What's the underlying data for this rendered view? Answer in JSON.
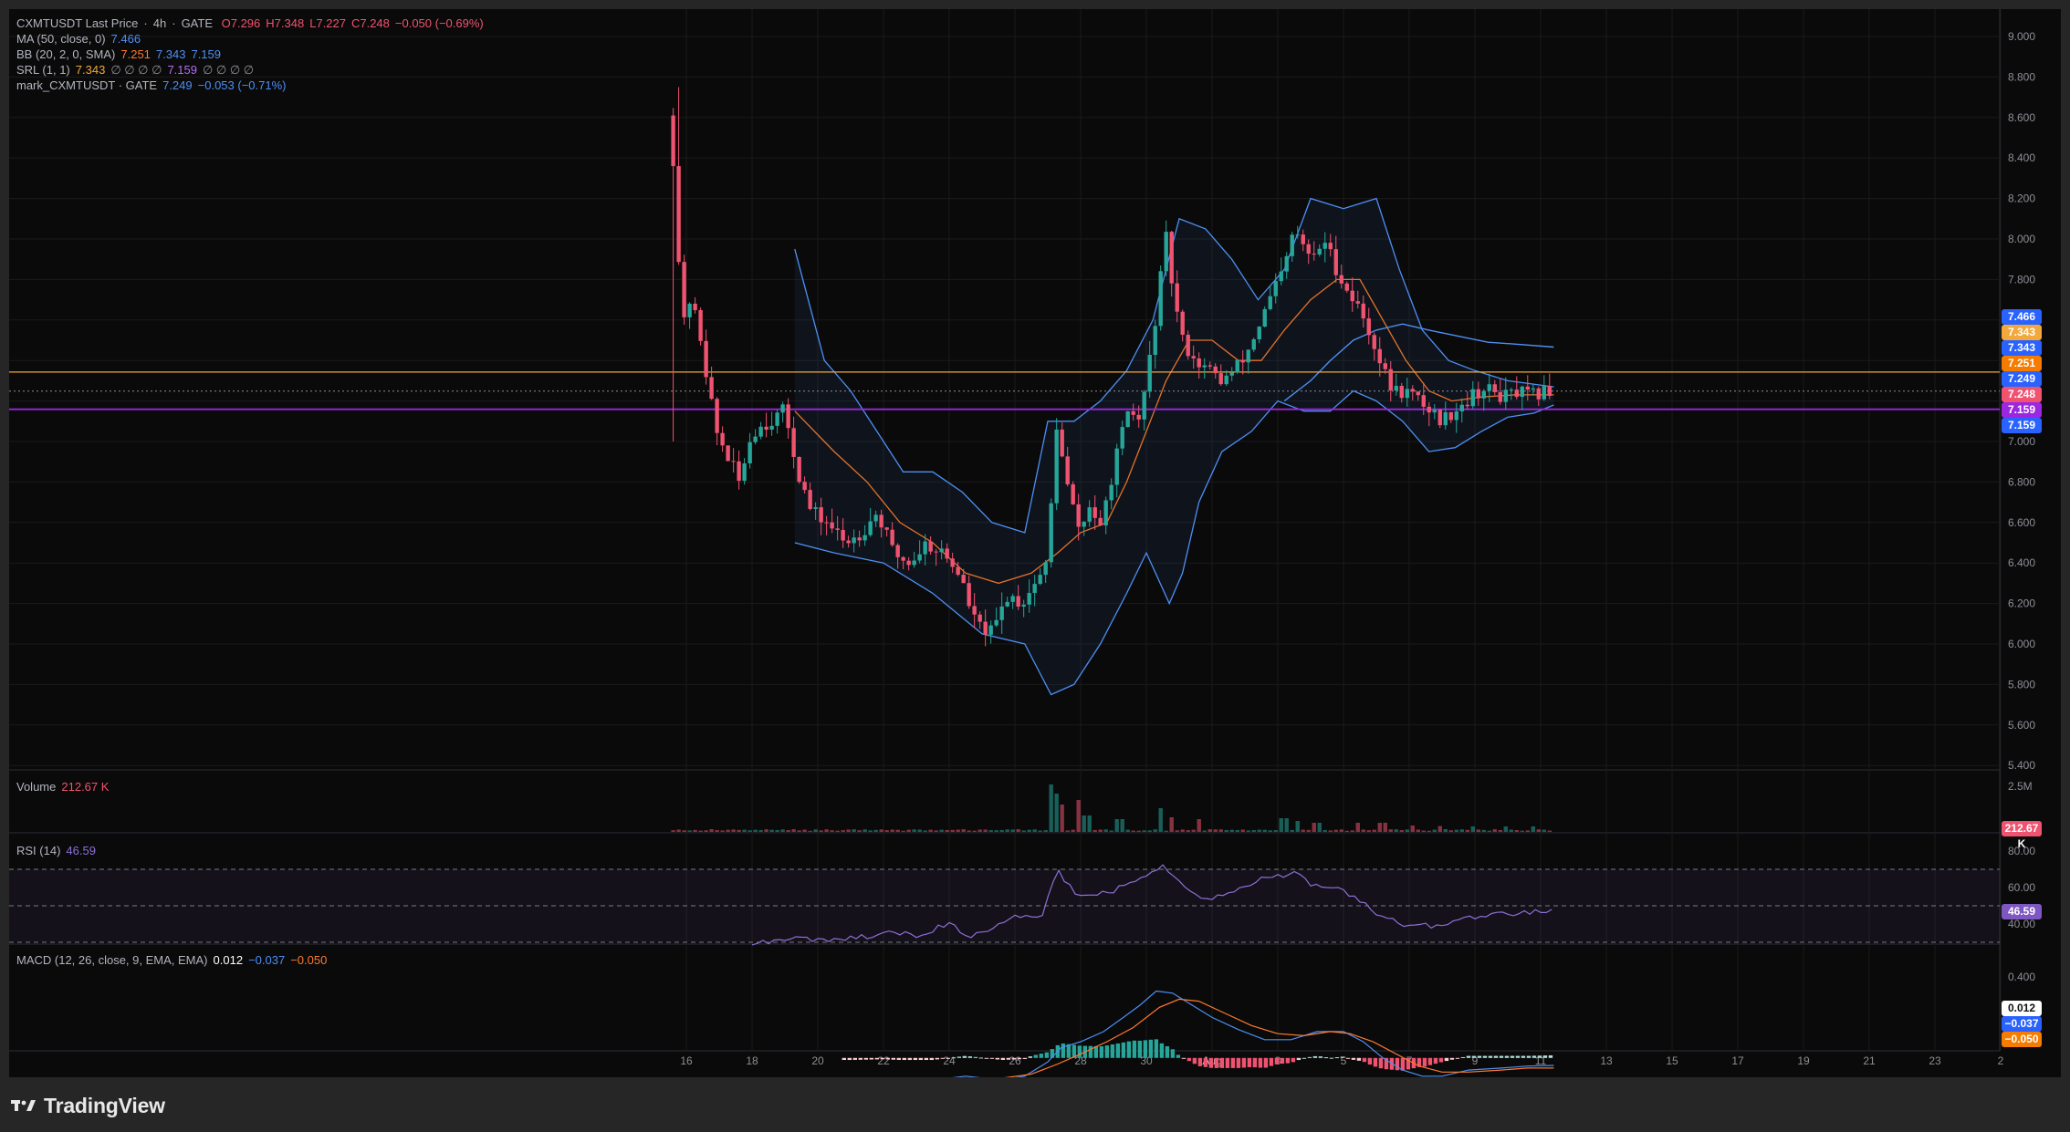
{
  "colors": {
    "bull": "#26a69a",
    "bear": "#ef5370",
    "ma": "#4d8ff5",
    "bb_basis": "#e4722a",
    "bb_band": "#4d8ff5",
    "srl_high": "#f2a83b",
    "srl_low": "#9c27e0",
    "rsi": "#8e70d6",
    "macd": "#4d8ff5",
    "signal": "#ff7a2e"
  },
  "header": {
    "symbol": "CXMTUSDT Last Price",
    "sep1": "·",
    "interval": "4h",
    "sep2": "·",
    "exchange": "GATE",
    "open": "O7.296",
    "high": "H7.348",
    "low": "L7.227",
    "close": "C7.248",
    "change": "−0.050 (−0.69%)"
  },
  "indicators": {
    "ma": {
      "label": "MA (50, close, 0)",
      "value": "7.466"
    },
    "bb": {
      "label": "BB (20, 2, 0, SMA)",
      "v1": "7.251",
      "v2": "7.343",
      "v3": "7.159"
    },
    "srl": {
      "label": "SRL (1, 1)",
      "v1": "7.343",
      "e1": "∅ ∅ ∅ ∅",
      "v2": "7.159",
      "e2": "∅ ∅ ∅ ∅"
    },
    "mark": {
      "label": "mark_CXMTUSDT · GATE",
      "value": "7.249",
      "change": "−0.053 (−0.71%)"
    },
    "volume": {
      "label": "Volume",
      "value": "212.67 K"
    },
    "rsi": {
      "label": "RSI (14)",
      "value": "46.59"
    },
    "macd": {
      "label": "MACD (12, 26, close, 9, EMA, EMA)",
      "v1": "0.012",
      "v2": "−0.037",
      "v3": "−0.050"
    }
  },
  "price_axis": {
    "ticks": [
      "9.000",
      "8.800",
      "8.600",
      "8.400",
      "8.200",
      "8.000",
      "7.800",
      "7.600",
      "7.400",
      "7.200",
      "7.000",
      "6.800",
      "6.600",
      "6.400",
      "6.200",
      "6.000",
      "5.800",
      "5.600",
      "5.400"
    ],
    "tick_values": [
      9.0,
      8.8,
      8.6,
      8.4,
      8.2,
      8.0,
      7.8,
      7.6,
      7.4,
      7.2,
      7.0,
      6.8,
      6.6,
      6.4,
      6.2,
      6.0,
      5.8,
      5.6,
      5.4
    ],
    "tags": [
      {
        "label": "7.466",
        "value": 7.466,
        "color": "#2962ff"
      },
      {
        "label": "7.343",
        "value": 7.343,
        "color": "#f2a83b"
      },
      {
        "label": "7.343",
        "value": 7.343,
        "color": "#2962ff"
      },
      {
        "label": "7.251",
        "value": 7.251,
        "color": "#f57c00"
      },
      {
        "label": "7.249",
        "value": 7.249,
        "color": "#2962ff"
      },
      {
        "label": "7.248",
        "value": 7.248,
        "color": "#ef5370"
      },
      {
        "label": "7.159",
        "value": 7.159,
        "color": "#9c27e0"
      },
      {
        "label": "7.159",
        "value": 7.159,
        "color": "#2962ff"
      }
    ]
  },
  "volume_axis": {
    "ticks": [
      "2.5M"
    ],
    "tag": "212.67 K"
  },
  "rsi_axis": {
    "ticks": [
      "80.00",
      "60.00",
      "40.00"
    ],
    "tag": "46.59"
  },
  "macd_axis": {
    "ticks": [
      "0.400",
      "0.200"
    ],
    "tags": [
      {
        "label": "0.012",
        "bg": "#ffffff",
        "fg": "#111111"
      },
      {
        "label": "−0.037",
        "bg": "#2962ff",
        "fg": "#ffffff"
      },
      {
        "label": "−0.050",
        "bg": "#f57c00",
        "fg": "#ffffff"
      }
    ]
  },
  "time_axis": {
    "labels": [
      "16",
      "18",
      "20",
      "22",
      "24",
      "26",
      "28",
      "30",
      "Aug",
      "3",
      "5",
      "7",
      "9",
      "11",
      "13",
      "15",
      "17",
      "19",
      "21",
      "23",
      "2"
    ],
    "label_days": [
      16,
      18,
      20,
      22,
      24,
      26,
      28,
      30,
      32,
      34,
      36,
      38,
      40,
      42,
      44,
      46,
      48,
      50,
      52,
      54,
      56
    ]
  },
  "footer": {
    "brand": "TradingView"
  },
  "chart_data": {
    "type": "candlestick",
    "title": "CXMTUSDT Last Price · 4h · GATE",
    "x_unit": "day (July 16 = 16; Aug 1 = 32)",
    "ylim": [
      5.4,
      9.1
    ],
    "anchors": [
      [
        15.6,
        8.4
      ],
      [
        15.75,
        7.95
      ],
      [
        15.9,
        7.55
      ],
      [
        16.1,
        7.7
      ],
      [
        16.4,
        7.55
      ],
      [
        16.6,
        7.35
      ],
      [
        16.9,
        7.05
      ],
      [
        17.2,
        6.95
      ],
      [
        17.6,
        6.8
      ],
      [
        18.0,
        7.05
      ],
      [
        18.5,
        7.1
      ],
      [
        19.0,
        7.15
      ],
      [
        19.4,
        6.85
      ],
      [
        19.8,
        6.65
      ],
      [
        20.3,
        6.6
      ],
      [
        20.8,
        6.5
      ],
      [
        21.3,
        6.55
      ],
      [
        21.8,
        6.65
      ],
      [
        22.3,
        6.45
      ],
      [
        22.8,
        6.4
      ],
      [
        23.3,
        6.5
      ],
      [
        23.8,
        6.45
      ],
      [
        24.3,
        6.35
      ],
      [
        24.8,
        6.1
      ],
      [
        25.3,
        6.05
      ],
      [
        25.8,
        6.25
      ],
      [
        26.2,
        6.2
      ],
      [
        26.6,
        6.3
      ],
      [
        27.0,
        6.4
      ],
      [
        27.25,
        7.1
      ],
      [
        27.45,
        6.9
      ],
      [
        27.7,
        6.7
      ],
      [
        28.0,
        6.55
      ],
      [
        28.3,
        6.7
      ],
      [
        28.6,
        6.55
      ],
      [
        28.9,
        6.8
      ],
      [
        29.2,
        7.0
      ],
      [
        29.5,
        7.15
      ],
      [
        29.8,
        7.1
      ],
      [
        30.1,
        7.4
      ],
      [
        30.35,
        7.7
      ],
      [
        30.6,
        8.0
      ],
      [
        30.85,
        7.7
      ],
      [
        31.1,
        7.5
      ],
      [
        31.5,
        7.4
      ],
      [
        31.9,
        7.35
      ],
      [
        32.3,
        7.3
      ],
      [
        32.7,
        7.35
      ],
      [
        33.1,
        7.45
      ],
      [
        33.5,
        7.6
      ],
      [
        33.9,
        7.75
      ],
      [
        34.2,
        7.85
      ],
      [
        34.5,
        8.05
      ],
      [
        34.8,
        7.95
      ],
      [
        35.1,
        7.9
      ],
      [
        35.4,
        8.0
      ],
      [
        35.8,
        7.85
      ],
      [
        36.1,
        7.75
      ],
      [
        36.5,
        7.65
      ],
      [
        36.9,
        7.5
      ],
      [
        37.2,
        7.35
      ],
      [
        37.5,
        7.25
      ],
      [
        37.9,
        7.25
      ],
      [
        38.3,
        7.2
      ],
      [
        38.7,
        7.15
      ],
      [
        39.0,
        7.1
      ],
      [
        39.3,
        7.15
      ],
      [
        39.7,
        7.2
      ],
      [
        40.1,
        7.25
      ],
      [
        40.5,
        7.25
      ],
      [
        40.9,
        7.22
      ],
      [
        41.3,
        7.24
      ],
      [
        41.7,
        7.22
      ],
      [
        42.2,
        7.25
      ],
      [
        42.4,
        7.25
      ]
    ],
    "bb_lower": [
      [
        19.3,
        6.5
      ],
      [
        20.5,
        6.45
      ],
      [
        22.0,
        6.4
      ],
      [
        23.5,
        6.25
      ],
      [
        25.0,
        6.05
      ],
      [
        26.3,
        6.0
      ],
      [
        27.1,
        5.75
      ],
      [
        27.8,
        5.8
      ],
      [
        28.6,
        6.0
      ],
      [
        29.4,
        6.25
      ],
      [
        30.0,
        6.45
      ],
      [
        30.7,
        6.2
      ],
      [
        31.1,
        6.35
      ],
      [
        31.6,
        6.7
      ],
      [
        32.3,
        6.95
      ],
      [
        33.2,
        7.05
      ],
      [
        34.0,
        7.2
      ],
      [
        34.8,
        7.15
      ],
      [
        35.6,
        7.15
      ],
      [
        36.3,
        7.25
      ],
      [
        37.0,
        7.2
      ],
      [
        37.8,
        7.1
      ],
      [
        38.6,
        6.95
      ],
      [
        39.4,
        6.97
      ],
      [
        40.2,
        7.05
      ],
      [
        41.0,
        7.12
      ],
      [
        41.8,
        7.14
      ],
      [
        42.4,
        7.18
      ]
    ],
    "bb_upper": [
      [
        19.3,
        7.95
      ],
      [
        20.2,
        7.4
      ],
      [
        21.0,
        7.25
      ],
      [
        21.8,
        7.05
      ],
      [
        22.6,
        6.85
      ],
      [
        23.5,
        6.85
      ],
      [
        24.4,
        6.75
      ],
      [
        25.3,
        6.6
      ],
      [
        26.3,
        6.55
      ],
      [
        27.0,
        7.1
      ],
      [
        27.8,
        7.1
      ],
      [
        28.6,
        7.2
      ],
      [
        29.4,
        7.35
      ],
      [
        30.2,
        7.6
      ],
      [
        31.0,
        8.1
      ],
      [
        31.8,
        8.05
      ],
      [
        32.6,
        7.9
      ],
      [
        33.4,
        7.7
      ],
      [
        34.2,
        7.85
      ],
      [
        35.0,
        8.2
      ],
      [
        36.0,
        8.15
      ],
      [
        37.0,
        8.2
      ],
      [
        37.7,
        7.85
      ],
      [
        38.4,
        7.55
      ],
      [
        39.2,
        7.4
      ],
      [
        40.0,
        7.35
      ],
      [
        41.0,
        7.3
      ],
      [
        42.4,
        7.27
      ]
    ],
    "bb_basis": [
      [
        19.3,
        7.15
      ],
      [
        20.5,
        6.95
      ],
      [
        21.5,
        6.8
      ],
      [
        22.5,
        6.6
      ],
      [
        23.5,
        6.5
      ],
      [
        24.5,
        6.35
      ],
      [
        25.5,
        6.3
      ],
      [
        26.5,
        6.35
      ],
      [
        27.3,
        6.45
      ],
      [
        28.0,
        6.55
      ],
      [
        28.8,
        6.6
      ],
      [
        29.4,
        6.8
      ],
      [
        30.0,
        7.05
      ],
      [
        30.6,
        7.3
      ],
      [
        31.3,
        7.5
      ],
      [
        32.0,
        7.5
      ],
      [
        32.8,
        7.4
      ],
      [
        33.5,
        7.4
      ],
      [
        34.2,
        7.55
      ],
      [
        35.0,
        7.7
      ],
      [
        35.8,
        7.8
      ],
      [
        36.5,
        7.8
      ],
      [
        37.2,
        7.6
      ],
      [
        37.9,
        7.4
      ],
      [
        38.6,
        7.25
      ],
      [
        39.3,
        7.2
      ],
      [
        40.2,
        7.22
      ],
      [
        41.2,
        7.23
      ],
      [
        42.4,
        7.23
      ]
    ],
    "ma50": [
      [
        34.2,
        7.2
      ],
      [
        35.0,
        7.3
      ],
      [
        35.6,
        7.4
      ],
      [
        36.3,
        7.5
      ],
      [
        37.0,
        7.55
      ],
      [
        37.8,
        7.58
      ],
      [
        38.6,
        7.55
      ],
      [
        39.5,
        7.52
      ],
      [
        40.4,
        7.49
      ],
      [
        41.3,
        7.48
      ],
      [
        42.4,
        7.466
      ]
    ],
    "srl": [
      {
        "name": "SRL high",
        "value": 7.343
      },
      {
        "name": "SRL low",
        "value": 7.159
      }
    ],
    "volume": {
      "ylim": [
        0,
        3200000
      ],
      "spikes": [
        [
          27.1,
          2600000
        ],
        [
          27.25,
          2100000
        ],
        [
          27.4,
          1500000
        ],
        [
          28.0,
          1750000
        ],
        [
          28.2,
          900000
        ],
        [
          29.2,
          700000
        ],
        [
          30.4,
          1300000
        ],
        [
          30.8,
          800000
        ],
        [
          31.6,
          700000
        ],
        [
          34.2,
          750000
        ],
        [
          34.6,
          600000
        ],
        [
          35.2,
          500000
        ],
        [
          36.4,
          500000
        ],
        [
          37.2,
          500000
        ],
        [
          38.1,
          350000
        ],
        [
          39.0,
          320000
        ],
        [
          40.0,
          300000
        ],
        [
          41.0,
          300000
        ],
        [
          41.8,
          300000
        ]
      ]
    },
    "rsi": {
      "ylim": [
        20,
        85
      ],
      "bands": [
        70,
        50,
        30
      ],
      "points": [
        [
          18.0,
          30
        ],
        [
          19.0,
          31
        ],
        [
          19.5,
          33
        ],
        [
          20.3,
          30
        ],
        [
          21.0,
          32
        ],
        [
          22.2,
          35
        ],
        [
          23.0,
          34
        ],
        [
          24.0,
          40
        ],
        [
          24.7,
          33
        ],
        [
          25.6,
          40
        ],
        [
          26.2,
          45
        ],
        [
          26.8,
          44
        ],
        [
          27.1,
          62
        ],
        [
          27.3,
          70
        ],
        [
          27.6,
          62
        ],
        [
          28.0,
          55
        ],
        [
          28.5,
          57
        ],
        [
          29.0,
          58
        ],
        [
          29.4,
          62
        ],
        [
          29.8,
          65
        ],
        [
          30.2,
          70
        ],
        [
          30.5,
          72
        ],
        [
          30.8,
          67
        ],
        [
          31.2,
          60
        ],
        [
          31.8,
          54
        ],
        [
          32.2,
          55
        ],
        [
          32.7,
          58
        ],
        [
          33.2,
          62
        ],
        [
          33.8,
          67
        ],
        [
          34.2,
          65
        ],
        [
          34.6,
          70
        ],
        [
          34.9,
          63
        ],
        [
          35.3,
          60
        ],
        [
          35.8,
          61
        ],
        [
          36.3,
          55
        ],
        [
          36.7,
          52
        ],
        [
          37.0,
          45
        ],
        [
          37.5,
          43
        ],
        [
          37.9,
          39
        ],
        [
          38.4,
          40
        ],
        [
          38.8,
          38
        ],
        [
          39.3,
          42
        ],
        [
          39.8,
          43
        ],
        [
          40.3,
          44
        ],
        [
          40.8,
          46
        ],
        [
          41.3,
          45
        ],
        [
          41.8,
          47
        ],
        [
          42.4,
          46.59
        ]
      ]
    },
    "macd": {
      "ylim": [
        -0.25,
        0.45
      ],
      "macd_line": [
        [
          21.0,
          -0.12
        ],
        [
          22.0,
          -0.11
        ],
        [
          23.5,
          -0.11
        ],
        [
          24.5,
          -0.09
        ],
        [
          25.6,
          -0.11
        ],
        [
          26.3,
          -0.09
        ],
        [
          27.0,
          -0.02
        ],
        [
          27.4,
          0.05
        ],
        [
          28.0,
          0.08
        ],
        [
          28.7,
          0.13
        ],
        [
          29.3,
          0.2
        ],
        [
          29.8,
          0.26
        ],
        [
          30.3,
          0.33
        ],
        [
          30.8,
          0.32
        ],
        [
          31.3,
          0.27
        ],
        [
          32.0,
          0.2
        ],
        [
          32.8,
          0.14
        ],
        [
          33.6,
          0.09
        ],
        [
          34.4,
          0.09
        ],
        [
          35.2,
          0.13
        ],
        [
          36.0,
          0.13
        ],
        [
          36.6,
          0.08
        ],
        [
          37.2,
          0.0
        ],
        [
          37.8,
          -0.06
        ],
        [
          38.4,
          -0.09
        ],
        [
          39.0,
          -0.09
        ],
        [
          39.8,
          -0.06
        ],
        [
          40.8,
          -0.05
        ],
        [
          41.6,
          -0.04
        ],
        [
          42.4,
          -0.037
        ]
      ],
      "signal_line": [
        [
          21.0,
          -0.11
        ],
        [
          22.5,
          -0.1
        ],
        [
          24.0,
          -0.1
        ],
        [
          25.6,
          -0.1
        ],
        [
          26.5,
          -0.08
        ],
        [
          27.3,
          -0.03
        ],
        [
          28.0,
          0.02
        ],
        [
          28.8,
          0.08
        ],
        [
          29.6,
          0.15
        ],
        [
          30.4,
          0.25
        ],
        [
          31.0,
          0.29
        ],
        [
          31.6,
          0.28
        ],
        [
          32.4,
          0.22
        ],
        [
          33.2,
          0.16
        ],
        [
          34.0,
          0.12
        ],
        [
          34.8,
          0.11
        ],
        [
          35.6,
          0.13
        ],
        [
          36.2,
          0.12
        ],
        [
          36.9,
          0.08
        ],
        [
          37.6,
          0.02
        ],
        [
          38.3,
          -0.04
        ],
        [
          39.0,
          -0.07
        ],
        [
          39.8,
          -0.07
        ],
        [
          40.8,
          -0.06
        ],
        [
          41.6,
          -0.05
        ],
        [
          42.4,
          -0.05
        ]
      ]
    }
  }
}
